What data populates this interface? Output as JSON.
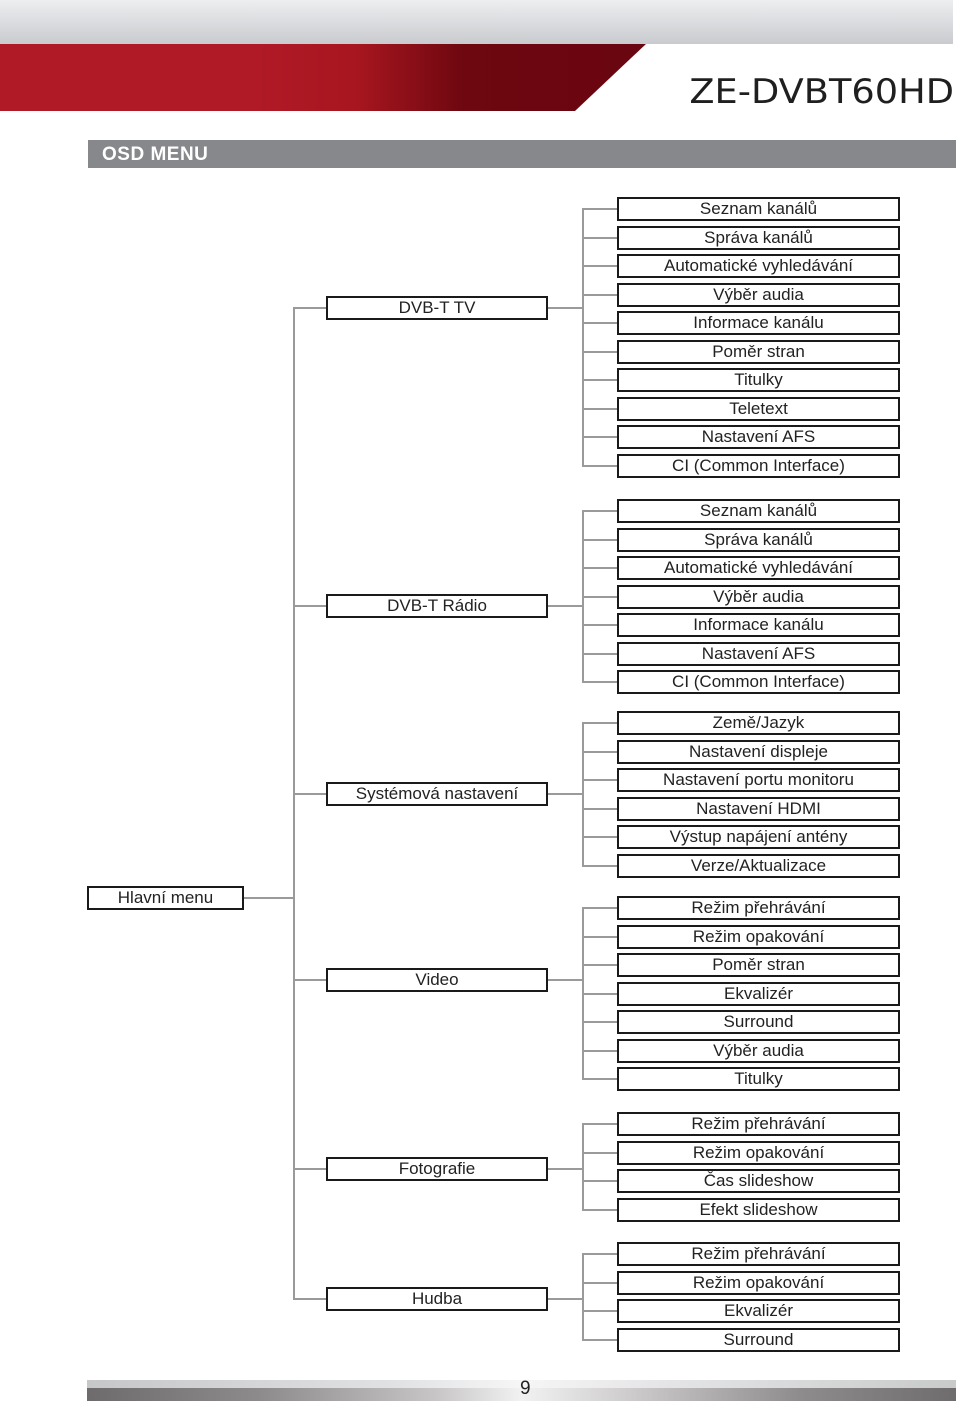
{
  "header": {
    "model": "ZE-DVBT60HD",
    "section_title": "OSD MENU",
    "colors": {
      "brand_red": "#b01a27",
      "brand_dark_red": "#6a0610",
      "section_gray": "#87888b"
    }
  },
  "tree": {
    "root": "Hlavní menu",
    "categories": [
      {
        "label": "DVB-T TV",
        "items": [
          "Seznam kanálů",
          "Správa kanálů",
          "Automatické vyhledávání",
          "Výběr audia",
          "Informace kanálu",
          "Poměr stran",
          "Titulky",
          "Teletext",
          "Nastavení AFS",
          "CI (Common Interface)"
        ]
      },
      {
        "label": "DVB-T Rádio",
        "items": [
          "Seznam kanálů",
          "Správa kanálů",
          "Automatické vyhledávání",
          "Výběr audia",
          "Informace kanálu",
          "Nastavení AFS",
          "CI (Common Interface)"
        ]
      },
      {
        "label": "Systémová nastavení",
        "items": [
          "Země/Jazyk",
          "Nastavení displeje",
          "Nastavení portu monitoru",
          "Nastavení HDMI",
          "Výstup napájení antény",
          "Verze/Aktualizace"
        ]
      },
      {
        "label": "Video",
        "items": [
          "Režim přehrávání",
          "Režim opakování",
          "Poměr stran",
          "Ekvalizér",
          "Surround",
          "Výběr audia",
          "Titulky"
        ]
      },
      {
        "label": "Fotografie",
        "items": [
          "Režim přehrávání",
          "Režim opakování",
          "Čas slideshow",
          "Efekt slideshow"
        ]
      },
      {
        "label": "Hudba",
        "items": [
          "Režim přehrávání",
          "Režim opakování",
          "Ekvalizér",
          "Surround"
        ]
      }
    ]
  },
  "footer": {
    "page_number": "9"
  }
}
